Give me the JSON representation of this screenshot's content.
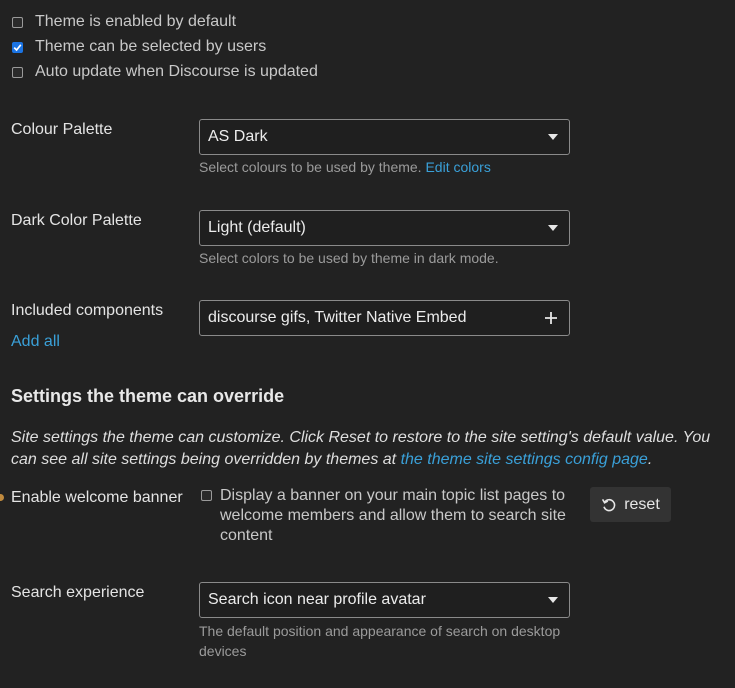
{
  "checkboxes": [
    {
      "label": "Theme is enabled by default",
      "checked": false
    },
    {
      "label": "Theme can be selected by users",
      "checked": true
    },
    {
      "label": "Auto update when Discourse is updated",
      "checked": false
    }
  ],
  "colour_palette": {
    "label": "Colour Palette",
    "value": "AS Dark",
    "help": "Select colours to be used by theme.",
    "help_link": "Edit colors"
  },
  "dark_palette": {
    "label": "Dark Color Palette",
    "value": "Light (default)",
    "help": "Select colors to be used by theme in dark mode."
  },
  "components": {
    "label": "Included components",
    "value": "discourse gifs, Twitter Native Embed",
    "add_all": "Add all"
  },
  "overrides": {
    "title": "Settings the theme can override",
    "desc": "Site settings the theme can customize. Click Reset to restore to the site setting's default value. You can see all site settings being overridden by themes at ",
    "desc_link": "the theme site settings config page",
    "desc_end": "."
  },
  "welcome_banner": {
    "label": "Enable welcome banner",
    "text": "Display a banner on your main topic list pages to welcome members and allow them to search site content",
    "checked": false,
    "reset": "reset",
    "modified_dot_color": "#c08a3e"
  },
  "search_experience": {
    "label": "Search experience",
    "value": "Search icon near profile avatar",
    "help": "The default position and appearance of search on desktop devices"
  },
  "colors": {
    "background": "#222222",
    "link": "#3aa0d8",
    "checkbox_checked": "#1b74e4"
  }
}
